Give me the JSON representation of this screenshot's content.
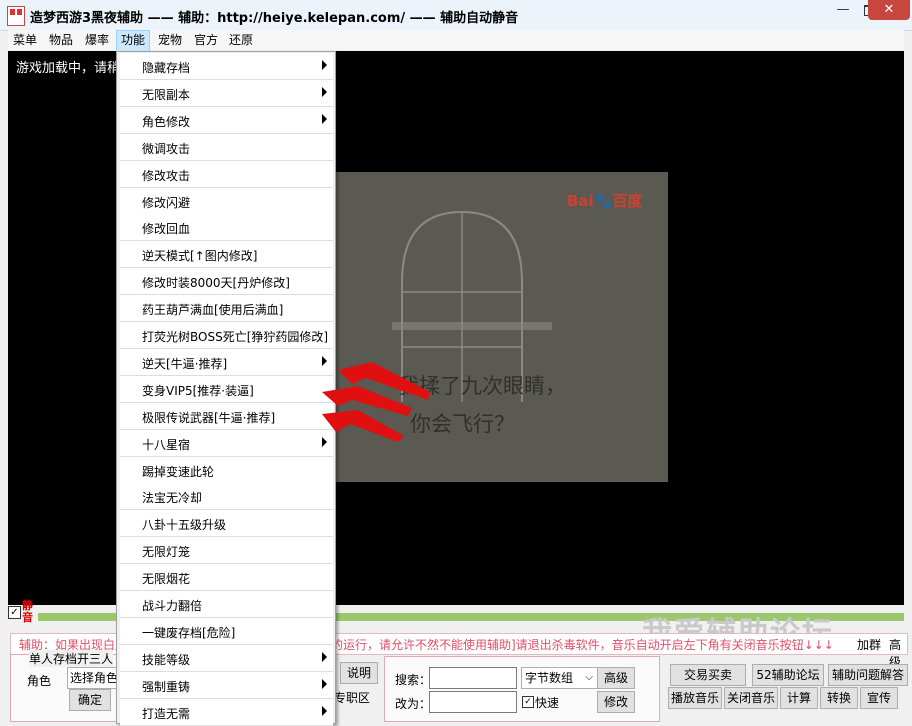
{
  "window": {
    "title": "造梦西游3黑夜辅助 —— 辅助：http://heiye.kelepan.com/ —— 辅助自动静音",
    "minimize": "—",
    "close": "✕"
  },
  "menubar": {
    "items": [
      "菜单",
      "物品",
      "爆率",
      "功能",
      "宠物",
      "官方",
      "还原"
    ],
    "active": "功能"
  },
  "game": {
    "loading_text": "游戏加载中，请稍",
    "overlay_logo": "Bai🐾百度",
    "overlay_line1": "我揉了九次眼睛，",
    "overlay_line2": "你会飞行？"
  },
  "dropdown": {
    "items": [
      {
        "label": "隐藏存档",
        "submenu": true
      },
      {
        "label": "无限副本",
        "submenu": true
      },
      {
        "label": "角色修改",
        "submenu": true
      },
      {
        "label": "微调攻击",
        "submenu": false
      },
      {
        "label": "修改攻击",
        "submenu": false
      },
      {
        "label": "修改闪避",
        "submenu": false
      },
      {
        "label": "修改回血",
        "submenu": false
      },
      {
        "label": "逆天模式[↑图内修改]",
        "submenu": false
      },
      {
        "label": "修改时装8000天[丹炉修改]",
        "submenu": false
      },
      {
        "label": "药王葫芦满血[使用后满血]",
        "submenu": false
      },
      {
        "label": "打荧光树BOSS死亡[狰狞药园修改]",
        "submenu": false
      },
      {
        "label": "逆天[牛逼·推荐]",
        "submenu": true
      },
      {
        "label": "变身VIP5[推荐·装逼]",
        "submenu": false
      },
      {
        "label": "极限传说武器[牛逼·推荐]",
        "submenu": false
      },
      {
        "label": "十八星宿",
        "submenu": true
      },
      {
        "label": "踢掉变速此轮",
        "submenu": false
      },
      {
        "label": "法宝无冷却",
        "submenu": false
      },
      {
        "label": "八卦十五级升级",
        "submenu": false
      },
      {
        "label": "无限灯笼",
        "submenu": false
      },
      {
        "label": "无限烟花",
        "submenu": false
      },
      {
        "label": "战斗力翻倍",
        "submenu": false
      },
      {
        "label": "一键废存档[危险]",
        "submenu": false
      },
      {
        "label": "技能等级",
        "submenu": true
      },
      {
        "label": "强制重铸",
        "submenu": true
      },
      {
        "label": "打造无需",
        "submenu": true
      }
    ]
  },
  "bottom": {
    "mute_label": "静音",
    "watermark": "我爱辅助论坛",
    "notice": "辅助：如果出现白屏，请关闭杀毒软件后重新打开辅助，如的运行，请允许不然不能使用辅助]请退出杀毒软件，音乐自动开启左下角有关闭音乐按钮↓↓↓",
    "join_group": "加群",
    "advanced_top": "高级",
    "single_archive": "单人存档开三人",
    "role_label": "角色",
    "select_role": "选择角色",
    "confirm": "确定",
    "explain": "说明",
    "duty": "专职区",
    "search_label": "搜索：",
    "search_value": "",
    "type_select": "字节数组",
    "advanced": "高级",
    "change_label": "改为：",
    "change_value": "",
    "fast_label": "快速",
    "modify": "修改",
    "trade": "交易买卖",
    "forum52": "52辅助论坛",
    "faq": "辅助问题解答",
    "play_music": "播放音乐",
    "stop_music": "关闭音乐",
    "calc": "计算",
    "convert": "转换",
    "promote": "宣传"
  }
}
